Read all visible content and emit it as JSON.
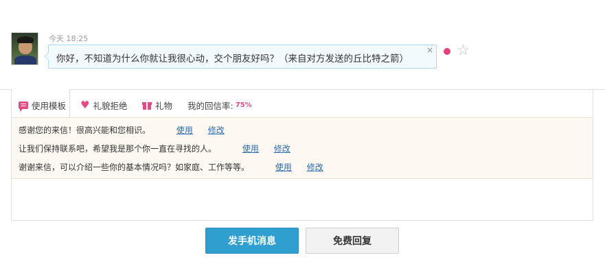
{
  "message": {
    "time": "今天  18:25",
    "text": "你好，不知道为什么你就让我很心动，交个朋友好吗？（来自对方发送的丘比特之箭）",
    "close_label": "×",
    "star_icon": "star-outline-icon",
    "unread_color": "#e8407a"
  },
  "tabs": {
    "templates": "使用模板",
    "decline": "礼貌拒绝",
    "gift": "礼物",
    "reply_rate_label": "我的回信率:",
    "reply_rate_value": "75%"
  },
  "templates": [
    {
      "text": "感谢您的来信！很高兴能和您相识。",
      "use": "使用",
      "edit": "修改"
    },
    {
      "text": "让我们保持联系吧，希望我是那个你一直在寻找的人。",
      "use": "使用",
      "edit": "修改"
    },
    {
      "text": "谢谢来信，可以介绍一些你的基本情况吗？如家庭、工作等等。",
      "use": "使用",
      "edit": "修改"
    }
  ],
  "reply_input": {
    "value": ""
  },
  "buttons": {
    "send_sms": "发手机消息",
    "free_reply": "免费回复"
  },
  "colors": {
    "accent": "#e34b86",
    "primary_button": "#2f9fd0",
    "link": "#2a6db0"
  }
}
